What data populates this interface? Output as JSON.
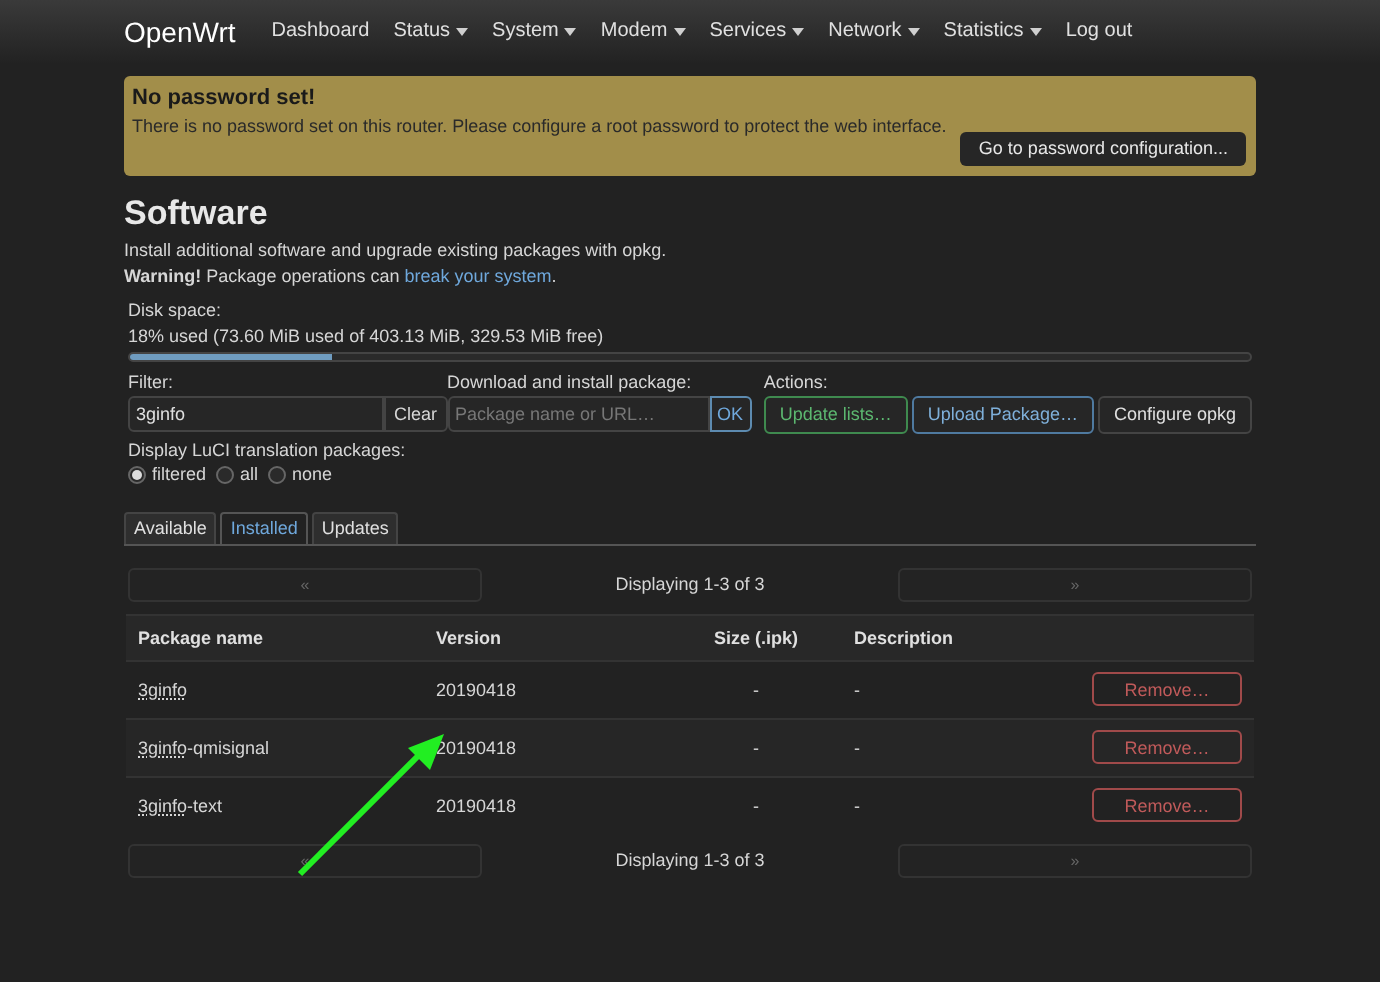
{
  "brand": "OpenWrt",
  "nav": [
    {
      "label": "Dashboard",
      "dropdown": false
    },
    {
      "label": "Status",
      "dropdown": true
    },
    {
      "label": "System",
      "dropdown": true
    },
    {
      "label": "Modem",
      "dropdown": true
    },
    {
      "label": "Services",
      "dropdown": true
    },
    {
      "label": "Network",
      "dropdown": true
    },
    {
      "label": "Statistics",
      "dropdown": true
    },
    {
      "label": "Log out",
      "dropdown": false
    }
  ],
  "alert": {
    "title": "No password set!",
    "message": "There is no password set on this router. Please configure a root password to protect the web interface.",
    "button": "Go to password configuration..."
  },
  "page": {
    "title": "Software",
    "description": "Install additional software and upgrade existing packages with opkg.",
    "warning_label": "Warning!",
    "warning_text": "Package operations can",
    "warning_link": "break your system",
    "warning_end": "."
  },
  "disk": {
    "label": "Disk space:",
    "reading": "18% used (73.60 MiB used of 403.13 MiB, 329.53 MiB free)",
    "level": 0.18
  },
  "filter": {
    "label": "Filter:",
    "value": "3ginfo",
    "clear": "Clear"
  },
  "download": {
    "label": "Download and install package:",
    "placeholder": "Package name or URL…",
    "button": "OK"
  },
  "actions": {
    "label": "Actions:",
    "buttons": [
      {
        "label": "Update lists…",
        "kind": "positive"
      },
      {
        "label": "Upload Package…",
        "kind": "action"
      },
      {
        "label": "Configure opkg",
        "kind": "neutral"
      }
    ]
  },
  "translation": {
    "label": "Display LuCI translation packages:",
    "options": [
      {
        "label": "filtered",
        "selected": true
      },
      {
        "label": "all",
        "selected": false
      },
      {
        "label": "none",
        "selected": false
      }
    ]
  },
  "tabs": [
    {
      "label": "Available",
      "selected": false
    },
    {
      "label": "Installed",
      "selected": true
    },
    {
      "label": "Updates",
      "selected": false
    }
  ],
  "pager_top": {
    "prev": "«",
    "status": "Displaying 1-3 of 3",
    "next": "»"
  },
  "table": {
    "columns": [
      "Package name",
      "Version",
      "Size (.ipk)",
      "Description"
    ],
    "rows": [
      {
        "name_match": "3ginfo",
        "name_rest": "",
        "version": "20190418",
        "size": "-",
        "description": "-",
        "action": "Remove…"
      },
      {
        "name_match": "3ginfo",
        "name_rest": "-qmisignal",
        "version": "20190418",
        "size": "-",
        "description": "-",
        "action": "Remove…"
      },
      {
        "name_match": "3ginfo",
        "name_rest": "-text",
        "version": "20190418",
        "size": "-",
        "description": "-",
        "action": "Remove…"
      }
    ]
  },
  "pager_bottom": {
    "prev": "«",
    "status": "Displaying 1-3 of 3",
    "next": "»"
  }
}
